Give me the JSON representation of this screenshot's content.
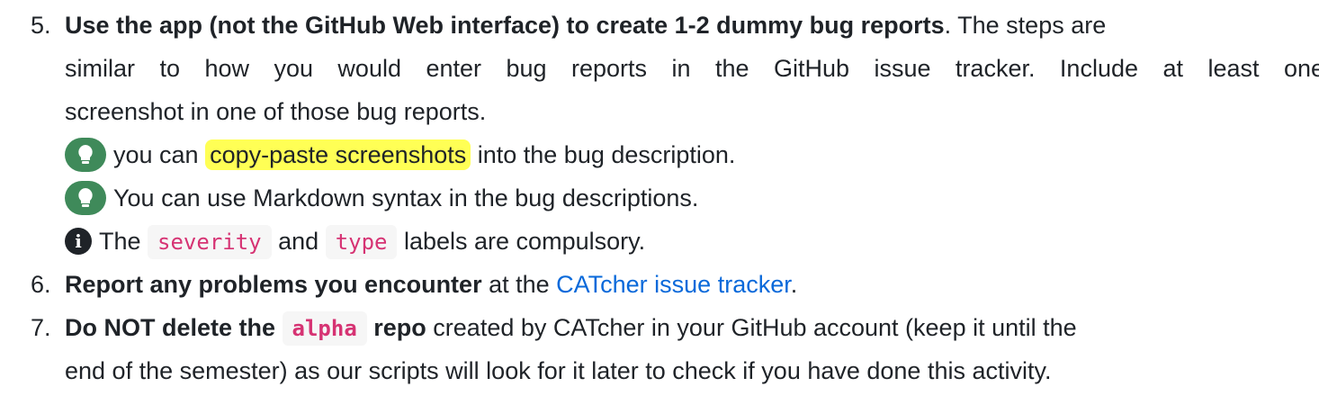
{
  "items": [
    {
      "number": "5.",
      "bold": "Use the app (not the GitHub Web interface) to create 1-2 dummy bug reports",
      "text1": ". The steps are",
      "line2": "similar to how you would enter bug reports in the GitHub issue tracker. Include at least one",
      "line3": "screenshot in one of those bug reports.",
      "tips": [
        {
          "icon": "lightbulb-icon",
          "pre": "you can ",
          "highlight": "copy-paste screenshots",
          "post": " into the bug description."
        },
        {
          "icon": "lightbulb-icon",
          "text": "You can use Markdown syntax in the bug descriptions."
        }
      ],
      "note": {
        "icon": "info-icon",
        "pre": "The ",
        "code1": "severity",
        "mid": " and ",
        "code2": "type",
        "post": " labels are compulsory."
      }
    },
    {
      "number": "6.",
      "bold": "Report any problems you encounter",
      "pre": " at the ",
      "link": "CATcher issue tracker",
      "post": "."
    },
    {
      "number": "7.",
      "bold1": "Do NOT delete the ",
      "code": "alpha",
      "bold2": " repo",
      "text": " created by CATcher in your GitHub account (keep it until the",
      "line2": "end of the semester) as our scripts will look for it later to check if you have done this activity."
    }
  ]
}
